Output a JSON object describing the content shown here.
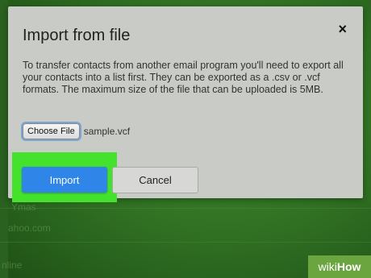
{
  "dialog": {
    "title": "Import from file",
    "close_icon": "×",
    "description": "To transfer contacts from another email program you'll need to export all your contacts into a list first. They can be exported as a .csv or .vcf formats. The maximum size of the file that can be uploaded is 5MB.",
    "choose_file_label": "Choose File",
    "file_name": "sample.vcf",
    "import_label": "Import",
    "cancel_label": "Cancel"
  },
  "background": {
    "partial_name": "Ymas",
    "partial_email": "ahoo.com",
    "partial_status": "nline"
  },
  "watermark": {
    "part1": "wiki",
    "part2": "How"
  },
  "colors": {
    "import_button": "#2f86e8",
    "highlight": "#44e22c",
    "dialog_bg": "#c8cbc6"
  }
}
